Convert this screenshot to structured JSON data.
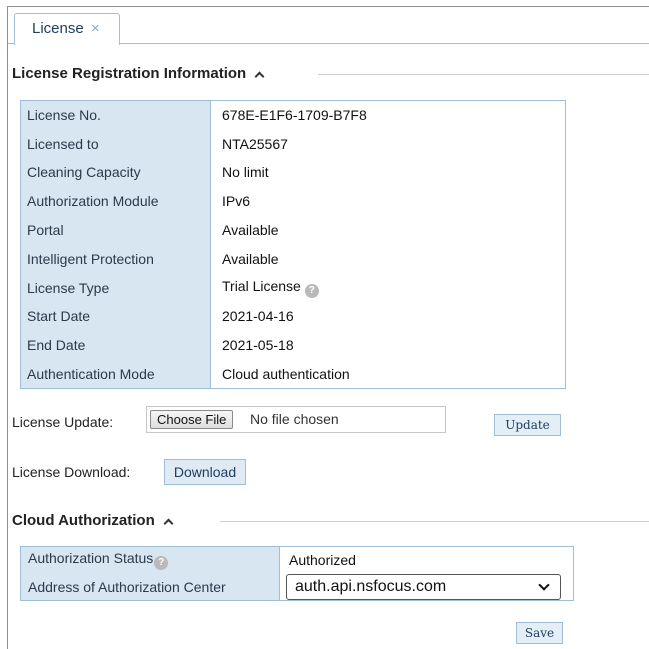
{
  "tab": {
    "label": "License",
    "close": "×"
  },
  "license_section": {
    "title": "License Registration Information",
    "rows": [
      {
        "key": "License No.",
        "value": "678E-E1F6-1709-B7F8"
      },
      {
        "key": "Licensed to",
        "value": "NTA25567"
      },
      {
        "key": "Cleaning Capacity",
        "value": "No limit"
      },
      {
        "key": "Authorization Module",
        "value": "IPv6"
      },
      {
        "key": "Portal",
        "value": "Available"
      },
      {
        "key": "Intelligent Protection",
        "value": "Available"
      },
      {
        "key": "License Type",
        "value": "Trial License"
      },
      {
        "key": "Start Date",
        "value": "2021-04-16"
      },
      {
        "key": "End Date",
        "value": "2021-05-18"
      },
      {
        "key": "Authentication Mode",
        "value": "Cloud authentication"
      }
    ]
  },
  "license_update": {
    "label": "License Update:",
    "choose_label": "Choose File",
    "no_file_text": "No file chosen",
    "update_label": "Update"
  },
  "license_download": {
    "label": "License Download:",
    "button_label": "Download"
  },
  "cloud_section": {
    "title": "Cloud Authorization",
    "status_label": "Authorization Status",
    "status_value": "Authorized",
    "address_label": "Address of Authorization Center",
    "address_value": "auth.api.nsfocus.com"
  },
  "save_label": "Save",
  "help_glyph": "?"
}
